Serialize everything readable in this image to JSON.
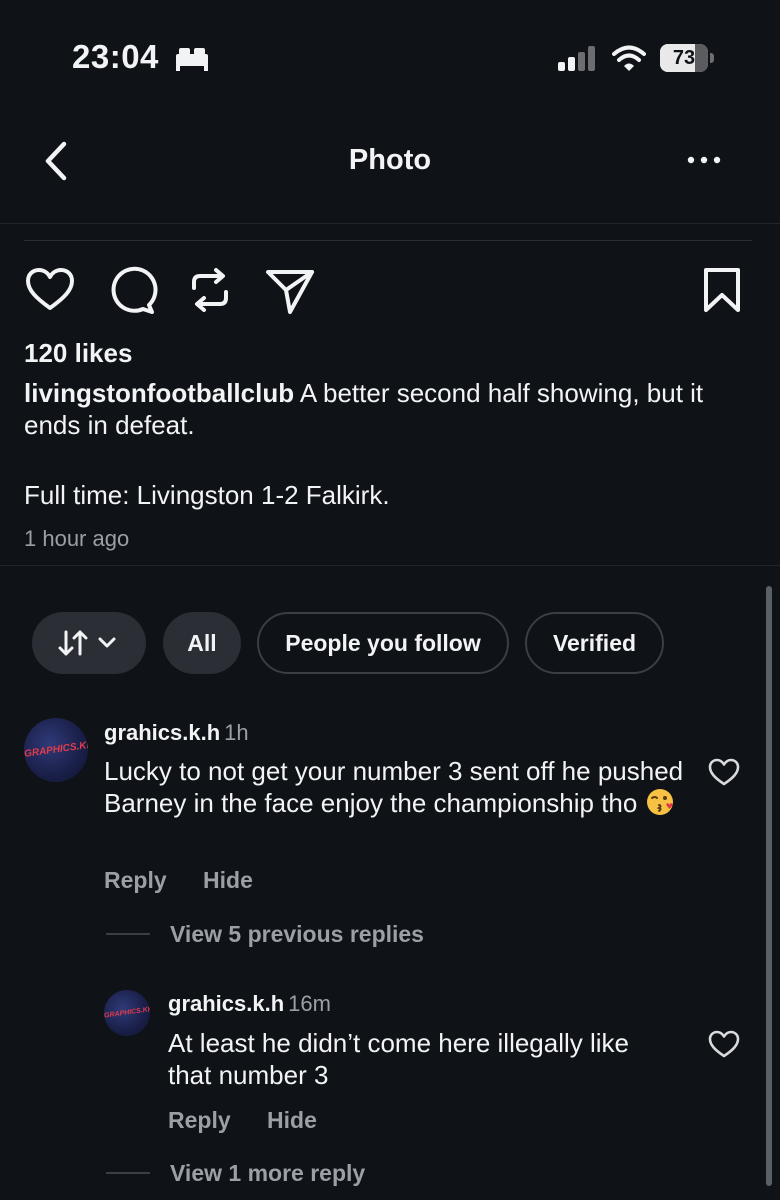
{
  "status_bar": {
    "time": "23:04",
    "battery": "73",
    "battery_level_percent": 73,
    "icons": [
      "sleep-focus-icon",
      "cellular-signal-icon",
      "wifi-icon",
      "battery-icon"
    ]
  },
  "header": {
    "title": "Photo",
    "back_icon": "chevron-left-icon",
    "more_icon": "more-horizontal-icon"
  },
  "post": {
    "action_icons": [
      "heart-icon",
      "comment-icon",
      "repost-icon",
      "share-icon",
      "bookmark-icon"
    ],
    "likes": "120 likes",
    "author": "livingstonfootballclub",
    "caption": " A better second half showing, but it ends in defeat.",
    "caption_line2": "Full time: Livingston 1-2 Falkirk.",
    "time_ago": "1 hour ago"
  },
  "filters": {
    "sort_icon": "sort-arrows-icon",
    "chips": [
      "All",
      "People you follow",
      "Verified"
    ]
  },
  "comments": [
    {
      "avatar_text": "GRAPHICS.KH",
      "user": "grahics.k.h",
      "time": "1h",
      "text": "Lucky to not get your number 3 sent off he pushed Barney in the face enjoy the championship tho",
      "emoji": "kissing-face-emoji",
      "reply": "Reply",
      "hide": "Hide",
      "view_replies": "View 5 previous replies"
    },
    {
      "avatar_text": "GRAPHICS.KH",
      "user": "grahics.k.h",
      "time": "16m",
      "text": "At least he didn’t come here illegally like that number 3",
      "reply": "Reply",
      "hide": "Hide",
      "view_replies": "View 1 more reply"
    }
  ],
  "colors": {
    "background": "#0f1216",
    "text": "#f2f3f5",
    "muted": "#9aa0a6",
    "chip_fill": "#2b2f35"
  }
}
